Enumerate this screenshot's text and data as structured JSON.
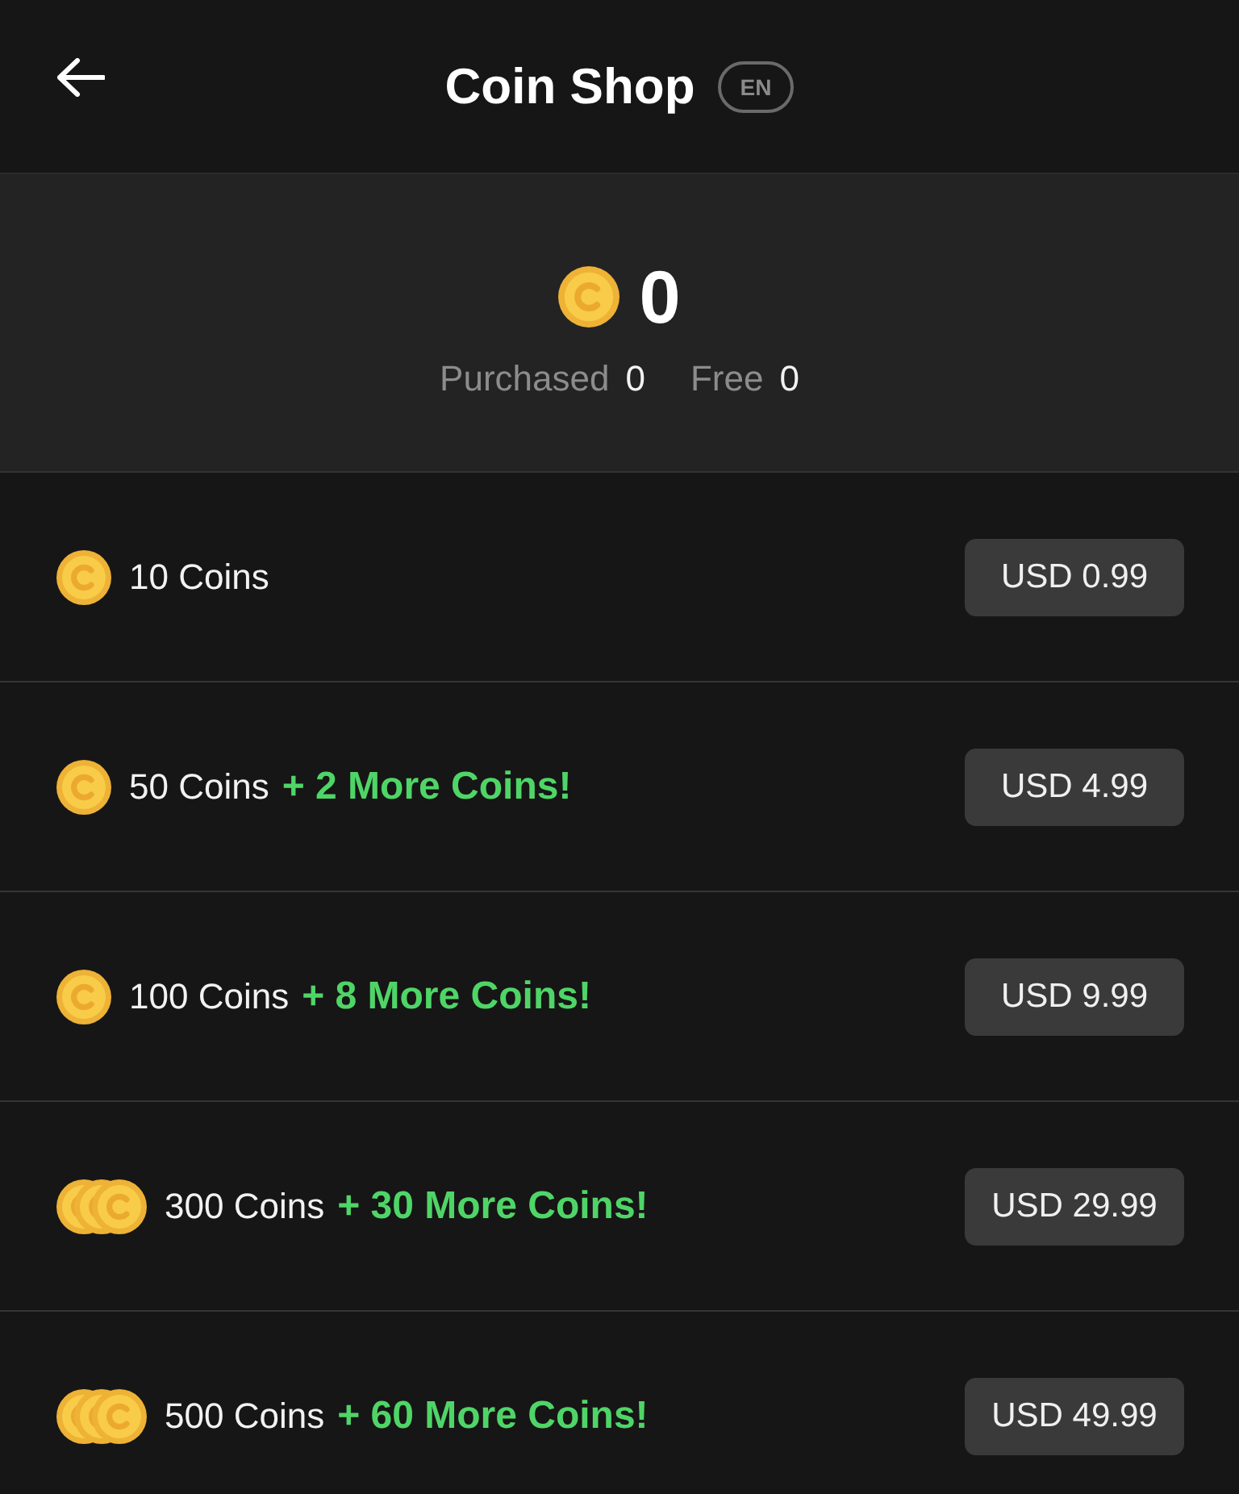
{
  "header": {
    "title": "Coin Shop",
    "language_badge": "EN"
  },
  "balance": {
    "total": "0",
    "purchased_label": "Purchased",
    "purchased": "0",
    "free_label": "Free",
    "free": "0"
  },
  "packages": [
    {
      "kind": "single",
      "coins": "10 Coins",
      "price": "USD 0.99"
    },
    {
      "kind": "single",
      "coins": "50 Coins",
      "bonus": "+ 2 More Coins!",
      "price": "USD 4.99"
    },
    {
      "kind": "single",
      "coins": "100 Coins",
      "bonus": "+ 8 More Coins!",
      "price": "USD 9.99"
    },
    {
      "kind": "stack",
      "coins": "300 Coins",
      "bonus": "+ 30 More Coins!",
      "price": "USD 29.99"
    },
    {
      "kind": "stack",
      "coins": "500 Coins",
      "bonus": "+ 60 More Coins!",
      "price": "USD 49.99"
    }
  ]
}
